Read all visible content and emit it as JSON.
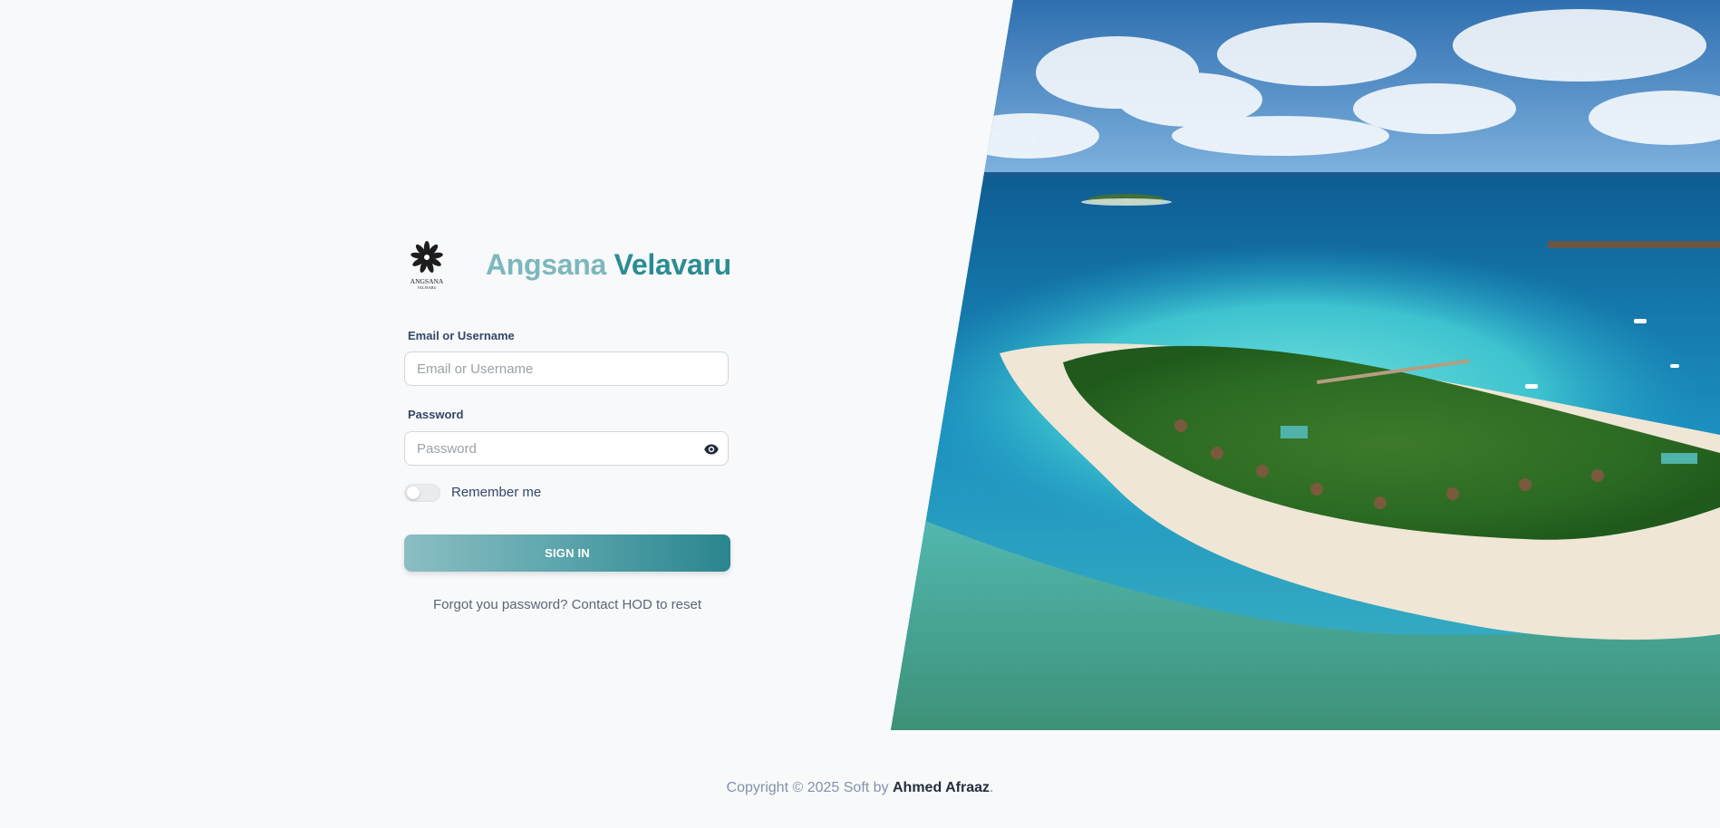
{
  "brand": {
    "logo_icon": "angsana-lotus-logo",
    "logo_text": "ANGSANA",
    "logo_subtext": "VELAVARU",
    "title_part1": "Angsana",
    "title_part2": "Velavaru",
    "colors": {
      "title_part1": "#7cb8be",
      "title_part2": "#2b8c95"
    }
  },
  "form": {
    "username": {
      "label": "Email or Username",
      "placeholder": "Email or Username",
      "value": ""
    },
    "password": {
      "label": "Password",
      "placeholder": "Password",
      "value": "",
      "toggle_icon": "eye-icon"
    },
    "remember": {
      "label": "Remember me",
      "checked": false
    },
    "submit_label": "SIGN IN",
    "forgot_text": "Forgot you password? Contact HOD to reset"
  },
  "hero": {
    "image_icon": "island-aerial-photo"
  },
  "footer": {
    "prefix": "Copyright © 2025 Soft by ",
    "author": "Ahmed Afraaz",
    "suffix": "."
  },
  "colors": {
    "accent": "#2b8c95",
    "background": "#f8f9fa",
    "text": "#344767"
  }
}
